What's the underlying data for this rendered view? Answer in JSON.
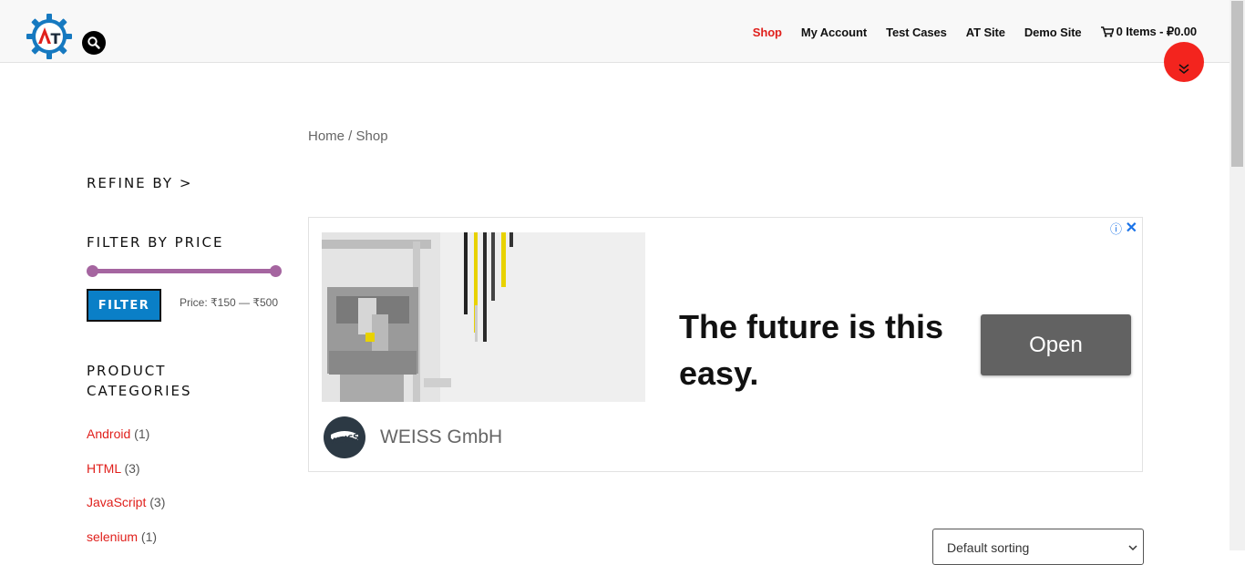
{
  "header": {
    "logo_letters": "AT",
    "nav": [
      {
        "label": "Shop",
        "active": true
      },
      {
        "label": "My Account"
      },
      {
        "label": "Test Cases"
      },
      {
        "label": "AT Site"
      },
      {
        "label": "Demo Site"
      }
    ],
    "cart_label": "0 Items - ₽0.00"
  },
  "breadcrumb": "Home / Shop",
  "sidebar": {
    "refine_title": "REFINE BY >",
    "filter_title": "FILTER BY PRICE",
    "filter_button": "FILTER",
    "price_label": "Price: ₹150 — ₹500",
    "price_range": {
      "min": 150,
      "max": 500
    },
    "categories_title_line1": "PRODUCT",
    "categories_title_line2": "CATEGORIES",
    "categories": [
      {
        "name": "Android",
        "count": "(1)"
      },
      {
        "name": "HTML",
        "count": "(3)"
      },
      {
        "name": "JavaScript",
        "count": "(3)"
      },
      {
        "name": "selenium",
        "count": "(1)"
      }
    ]
  },
  "ad": {
    "headline": "The future is this easy.",
    "cta": "Open",
    "advertiser": "WEISS GmbH",
    "advertiser_logo_text": "WEISS"
  },
  "sort": {
    "selected": "Default sorting"
  },
  "colors": {
    "accent": "#e0201c",
    "filter_button": "#0a7fc7",
    "slider": "#a565a0",
    "ad_cta": "#626262"
  }
}
